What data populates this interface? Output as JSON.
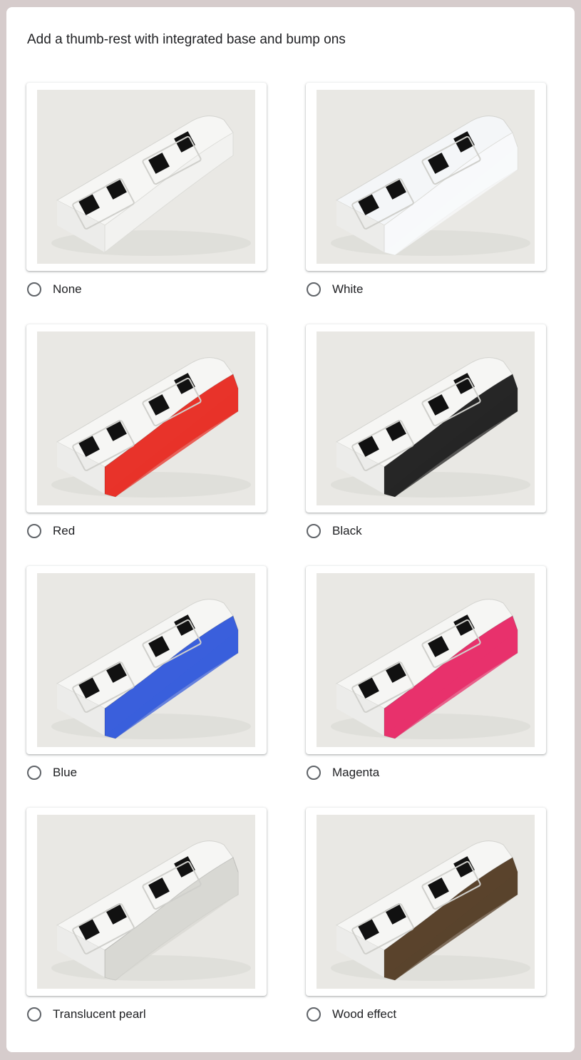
{
  "question": {
    "title": "Add a thumb-rest with integrated base and bump ons"
  },
  "options": [
    {
      "label": "None",
      "accent": "#f4f4f2",
      "base": "#f6f6f4"
    },
    {
      "label": "White",
      "accent": "#f8f9fb",
      "base": "#f4f6f8"
    },
    {
      "label": "Red",
      "accent": "#e8332a",
      "base": "#f6f6f4"
    },
    {
      "label": "Black",
      "accent": "#262626",
      "base": "#f6f6f4"
    },
    {
      "label": "Blue",
      "accent": "#3a5fdc",
      "base": "#f6f6f4"
    },
    {
      "label": "Magenta",
      "accent": "#e8316c",
      "base": "#f6f6f4"
    },
    {
      "label": "Translucent pearl",
      "accent": "#d8d8d3",
      "base": "#f6f6f4"
    },
    {
      "label": "Wood effect",
      "accent": "#5a432c",
      "base": "#f6f6f4"
    }
  ],
  "icons": {
    "radio": "radio-unchecked-icon"
  }
}
